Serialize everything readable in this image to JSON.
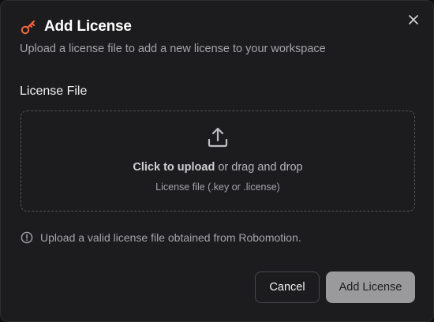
{
  "dialog": {
    "title": "Add License",
    "subtitle": "Upload a license file to add a new license to your workspace",
    "close_icon": "close-icon",
    "title_icon": "key-icon"
  },
  "field": {
    "label": "License File"
  },
  "dropzone": {
    "icon": "upload-icon",
    "click_text": "Click to upload",
    "drag_text": " or drag and drop",
    "hint": "License file (.key or .license)"
  },
  "info": {
    "icon": "info-icon",
    "text": "Upload a valid license file obtained from Robomotion."
  },
  "actions": {
    "cancel_label": "Cancel",
    "add_label": "Add License"
  },
  "colors": {
    "accent": "#f06a3c",
    "dialog_bg": "#1c1c1e",
    "primary_button_bg": "#9a9a9d"
  }
}
